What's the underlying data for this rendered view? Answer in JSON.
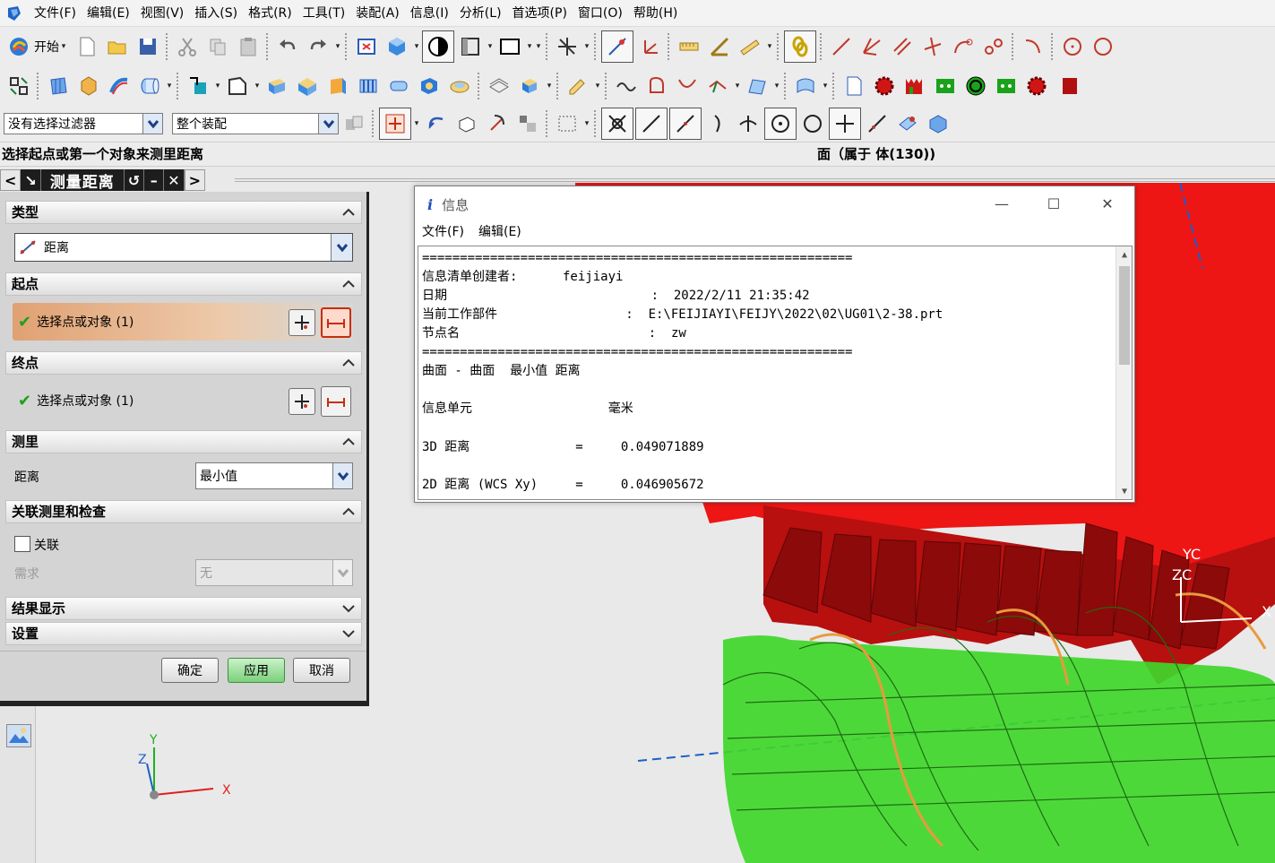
{
  "menu": [
    "文件(F)",
    "编辑(E)",
    "视图(V)",
    "插入(S)",
    "格式(R)",
    "工具(T)",
    "装配(A)",
    "信息(I)",
    "分析(L)",
    "首选项(P)",
    "窗口(O)",
    "帮助(H)"
  ],
  "toolbar": {
    "start_label": "开始"
  },
  "filters": {
    "type_filter": "没有选择过滤器",
    "scope_filter": "整个装配"
  },
  "status": {
    "prompt": "选择起点或第一个对象来测里距离",
    "selection": "面（属于 体(130))"
  },
  "dialog": {
    "title": "测量距离",
    "sections": {
      "type": "类型",
      "start": "起点",
      "end": "终点",
      "measure": "测里",
      "assoc": "关联测里和检查",
      "result": "结果显示",
      "settings": "设置"
    },
    "type_value": "距离",
    "start_select": "选择点或对象 (1)",
    "end_select": "选择点或对象 (1)",
    "distance_label": "距离",
    "distance_value": "最小值",
    "assoc_label": "关联",
    "require_label": "需求",
    "require_value": "无",
    "buttons": {
      "ok": "确定",
      "apply": "应用",
      "cancel": "取消"
    }
  },
  "info": {
    "title": "信息",
    "menu": [
      "文件(F)",
      "编辑(E)"
    ],
    "lines": [
      "=========================================================",
      "信息清单创建者:      feijiayi",
      "日期                           :  2022/2/11 21:35:42",
      "当前工作部件                 :  E:\\FEIJIAYI\\FEIJY\\2022\\02\\UG01\\2-38.prt",
      "节点名                         :  zw",
      "=========================================================",
      "曲面 - 曲面  最小值 距离",
      "",
      "信息单元                  毫米",
      "",
      "3D 距离              =     0.049071889",
      "",
      "2D 距离 (WCS Xy)     =     0.046905672"
    ]
  },
  "axes": {
    "x": "X",
    "y": "Y",
    "z": "Z",
    "xc": "X",
    "yc": "YC",
    "zc": "ZC"
  },
  "colors": {
    "gear": "#e01414",
    "worm": "#3fd62a",
    "highlight": "#e89a3e",
    "accent_blue": "#1d5fc8"
  }
}
